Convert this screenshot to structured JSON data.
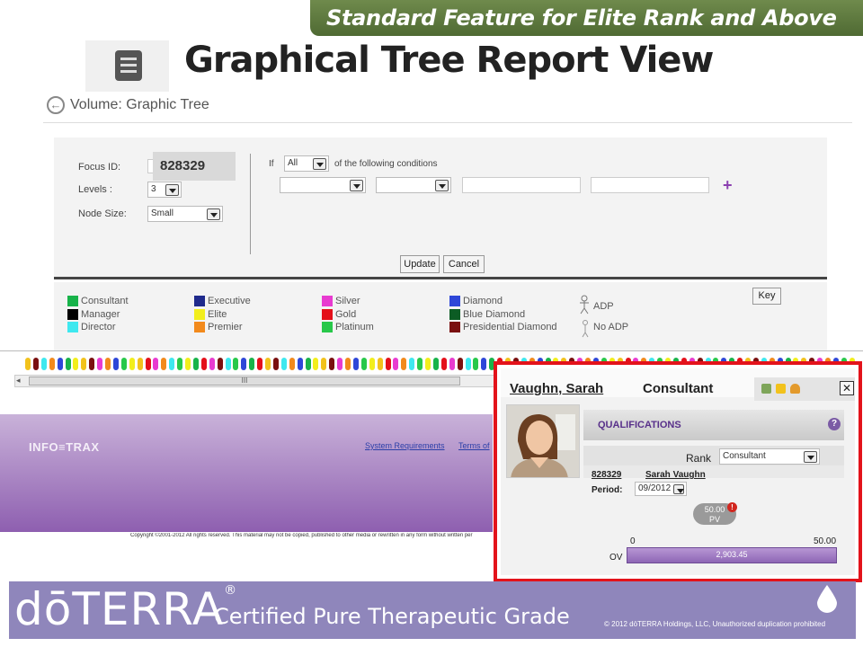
{
  "banner": {
    "text": "Standard Feature for Elite Rank and Above"
  },
  "title": {
    "text": "Graphical Tree Report View"
  },
  "breadcrumb": {
    "text": "Volume:  Graphic Tree"
  },
  "filter": {
    "focus_id_label": "Focus ID:",
    "focus_id_value": "828329",
    "levels_label": "Levels :",
    "levels_value": "3",
    "node_size_label": "Node Size:",
    "node_size_value": "Small",
    "if_label": "If",
    "condition_mode": "All",
    "condition_text": "of the following conditions",
    "update_label": "Update",
    "cancel_label": "Cancel"
  },
  "legend": {
    "items": [
      {
        "label": "Consultant",
        "color": "#18b34a"
      },
      {
        "label": "Manager",
        "color": "#000000"
      },
      {
        "label": "Director",
        "color": "#3ee8ef"
      },
      {
        "label": "Executive",
        "color": "#1f2a8c"
      },
      {
        "label": "Elite",
        "color": "#f2ee1c"
      },
      {
        "label": "Premier",
        "color": "#f28a1c"
      },
      {
        "label": "Silver",
        "color": "#e83bd0"
      },
      {
        "label": "Gold",
        "color": "#e4101a"
      },
      {
        "label": "Platinum",
        "color": "#28c84a"
      },
      {
        "label": "Diamond",
        "color": "#2e47d8"
      },
      {
        "label": "Blue Diamond",
        "color": "#0c5c24"
      },
      {
        "label": "Presidential Diamond",
        "color": "#7a1010"
      }
    ],
    "adp_label": "ADP",
    "no_adp_label": "No ADP",
    "key_label": "Key"
  },
  "scrollbar": {
    "grip": "III",
    "left_arrow": "◂"
  },
  "footer": {
    "brand": "INFO≡TRAX",
    "system_requirements": "System Requirements",
    "terms": "Terms of",
    "copyright": "Copyright ©2001-2012 All rights reserved. This material may not be copied, published to other media or rewritten in any form without written per"
  },
  "popup": {
    "name": "Vaughn, Sarah",
    "rank": "Consultant",
    "close": "✕",
    "qualifications_title": "QUALIFICATIONS",
    "help": "?",
    "rank_label": "Rank",
    "rank_value": "Consultant",
    "member_id": "828329",
    "member_name": "Sarah Vaughn",
    "period_label": "Period:",
    "period_value": "09/2012",
    "pv_value": "50.00",
    "pv_label": "PV",
    "pv_alert": "!",
    "scale_min": "0",
    "scale_max": "50.00",
    "ov_label": "OV",
    "ov_value": "2,903.45",
    "ov_progress": 1.0
  },
  "doterra": {
    "logo": "dōTERRA",
    "registered": "®",
    "tagline": "Certified Pure Therapeutic Grade",
    "copyright": "© 2012 dōTERRA Holdings, LLC, Unauthorized duplication  prohibited"
  },
  "tree_node_colors": [
    "#f2c21c",
    "#f28a1c",
    "#f2ee1c",
    "#e83bd0",
    "#28c84a",
    "#e4101a",
    "#3ee8ef",
    "#18b34a",
    "#7a1010",
    "#2e47d8"
  ]
}
